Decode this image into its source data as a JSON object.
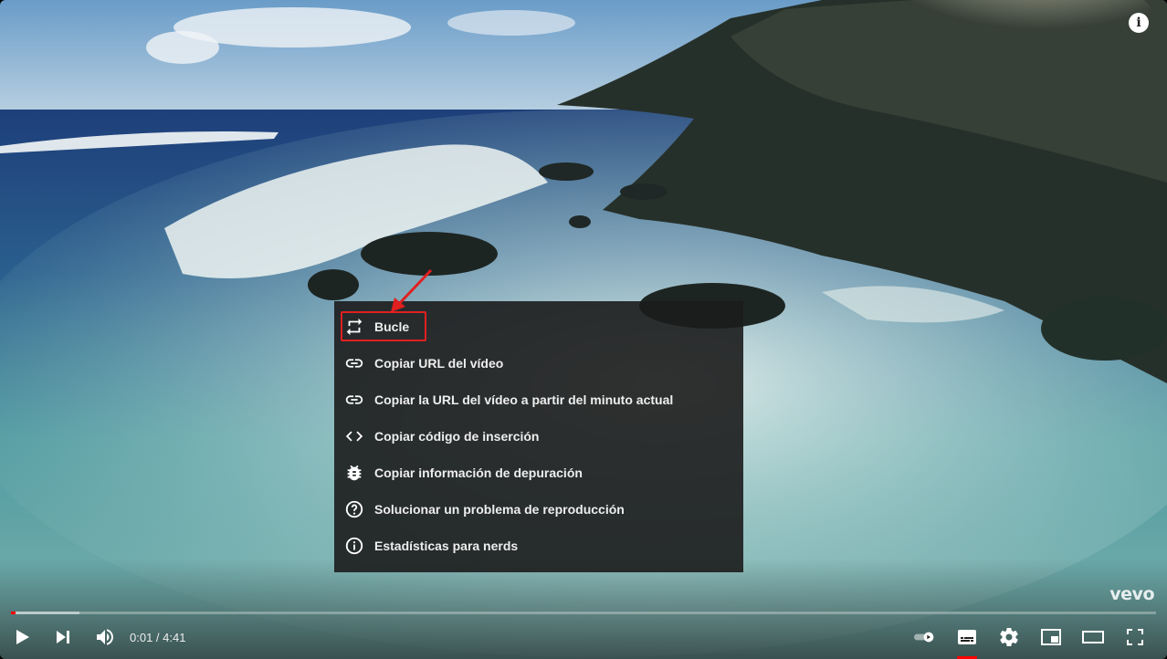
{
  "menu": {
    "items": [
      {
        "label": "Bucle",
        "icon": "loop-icon"
      },
      {
        "label": "Copiar URL del vídeo",
        "icon": "link-icon"
      },
      {
        "label": "Copiar la URL del vídeo a partir del minuto actual",
        "icon": "link-icon"
      },
      {
        "label": "Copiar código de inserción",
        "icon": "embed-code-icon"
      },
      {
        "label": "Copiar información de depuración",
        "icon": "bug-icon"
      },
      {
        "label": "Solucionar un problema de reproducción",
        "icon": "question-icon"
      },
      {
        "label": "Estadísticas para nerds",
        "icon": "info-icon"
      }
    ]
  },
  "overlay": {
    "watermark": "vevo",
    "info_icon_glyph": "i"
  },
  "player": {
    "current_time": "0:01",
    "separator": " / ",
    "duration": "4:41",
    "progress_fraction": 0.004,
    "captions_active": true,
    "autoplay_on": true
  },
  "colors": {
    "accent": "#ff0000",
    "menu_bg": "#1c1c1c",
    "highlight": "#e02020"
  }
}
